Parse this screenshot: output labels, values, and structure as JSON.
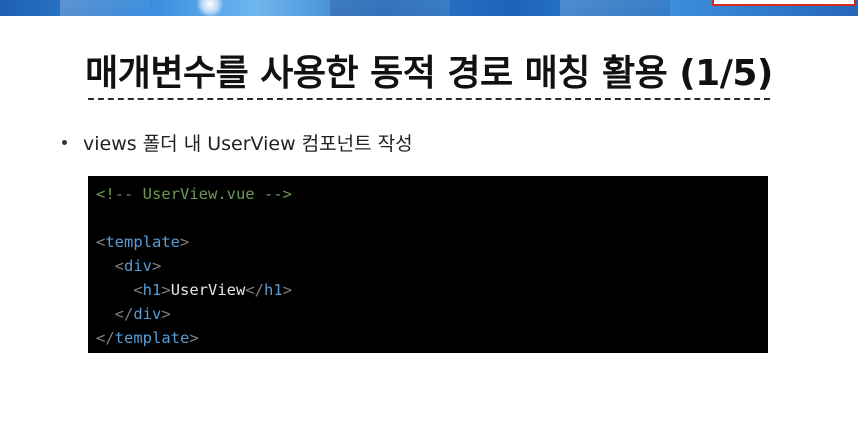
{
  "slide": {
    "title": "매개변수를 사용한 동적 경로 매칭 활용 (1/5)",
    "bullet": "views 폴더 내 UserView 컴포넌트 작성"
  },
  "code": {
    "language": "vue",
    "comment": "<!-- UserView.vue -->",
    "template_tag": "template",
    "div_tag": "div",
    "h1_tag": "h1",
    "h1_text": "UserView"
  },
  "colors": {
    "comment": "#6a9955",
    "tag": "#569cd6",
    "bracket": "#808080",
    "text": "#e6e6e6",
    "code_background": "#000000",
    "banner_accent": "#d42a2a"
  }
}
